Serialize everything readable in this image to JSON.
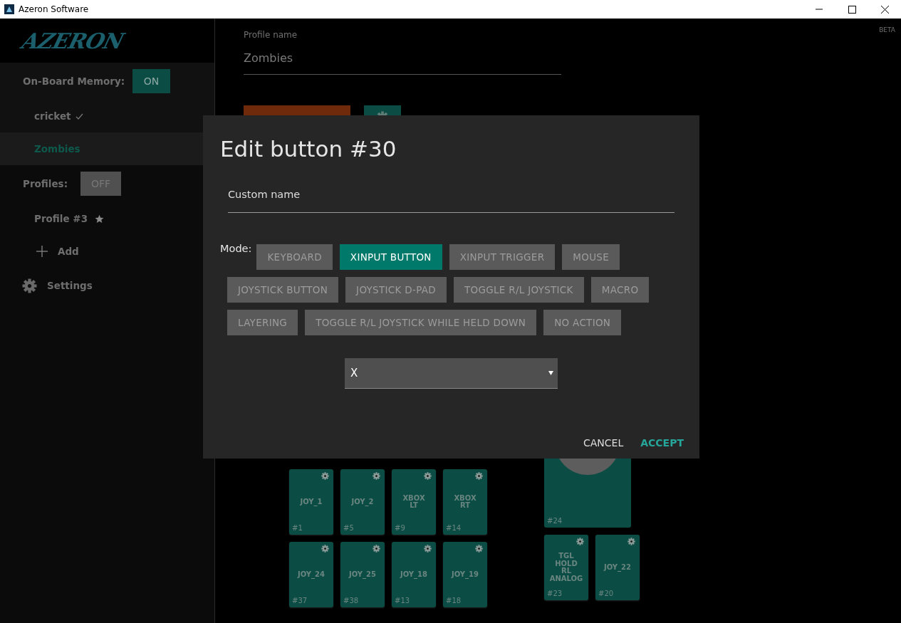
{
  "window": {
    "title": "Azeron Software"
  },
  "sidebar": {
    "logo": "AZERON",
    "onboard": {
      "label": "On-Board Memory:",
      "toggle": {
        "label": "ON",
        "on": true
      },
      "items": [
        {
          "name": "cricket",
          "active": true,
          "selected": false
        },
        {
          "name": "Zombies",
          "active": false,
          "selected": true
        }
      ]
    },
    "profiles": {
      "label": "Profiles:",
      "toggle": {
        "label": "OFF",
        "on": false
      },
      "items": [
        {
          "name": "Profile #3",
          "starred": true,
          "selected": false
        }
      ]
    },
    "add": "Add",
    "settings": "Settings"
  },
  "main": {
    "beta": "BETA",
    "profile_name": {
      "label": "Profile name",
      "value": "Zombies"
    },
    "keys_left": [
      [
        {
          "label": "JOY_1",
          "number": "#1"
        },
        {
          "label": "JOY_2",
          "number": "#5"
        },
        {
          "label": "XBOX LT",
          "number": "#9"
        },
        {
          "label": "XBOX RT",
          "number": "#14"
        }
      ],
      [
        {
          "label": "JOY_24",
          "number": "#37"
        },
        {
          "label": "JOY_25",
          "number": "#38"
        },
        {
          "label": "JOY_18",
          "number": "#13"
        },
        {
          "label": "JOY_19",
          "number": "#18"
        }
      ]
    ],
    "stick": {
      "number": "#24"
    },
    "keys_right": [
      {
        "label": "TGL HOLD RL ANALOG",
        "number": "#23"
      },
      {
        "label": "JOY_22",
        "number": "#20"
      }
    ]
  },
  "dialog": {
    "title": "Edit button #30",
    "custom_name": {
      "placeholder": "Custom name"
    },
    "mode_label": "Mode:",
    "modes": [
      {
        "label": "KEYBOARD",
        "selected": false
      },
      {
        "label": "XINPUT BUTTON",
        "selected": true
      },
      {
        "label": "XINPUT TRIGGER",
        "selected": false
      },
      {
        "label": "MOUSE",
        "selected": false
      },
      {
        "label": "JOYSTICK BUTTON",
        "selected": false
      },
      {
        "label": "JOYSTICK D-PAD",
        "selected": false
      },
      {
        "label": "TOGGLE R/L JOYSTICK",
        "selected": false
      },
      {
        "label": "MACRO",
        "selected": false
      },
      {
        "label": "LAYERING",
        "selected": false
      },
      {
        "label": "TOGGLE R/L JOYSTICK WHILE HELD DOWN",
        "selected": false
      },
      {
        "label": "NO ACTION",
        "selected": false
      }
    ],
    "select": {
      "value": "X"
    },
    "buttons": [
      {
        "label": "CANCEL",
        "kind": "secondary"
      },
      {
        "label": "ACCEPT",
        "kind": "primary"
      }
    ]
  }
}
